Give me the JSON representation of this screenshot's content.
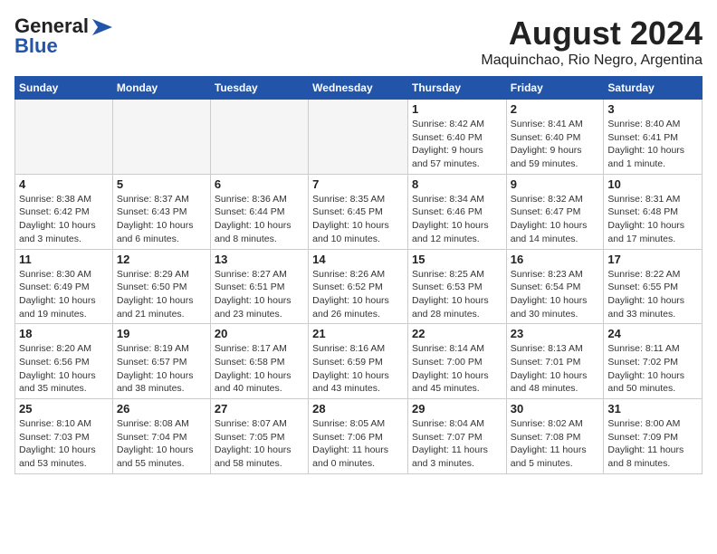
{
  "header": {
    "logo_line1": "General",
    "logo_line2": "Blue",
    "title": "August 2024",
    "subtitle": "Maquinchao, Rio Negro, Argentina"
  },
  "calendar": {
    "days_of_week": [
      "Sunday",
      "Monday",
      "Tuesday",
      "Wednesday",
      "Thursday",
      "Friday",
      "Saturday"
    ],
    "weeks": [
      [
        {
          "day": "",
          "info": ""
        },
        {
          "day": "",
          "info": ""
        },
        {
          "day": "",
          "info": ""
        },
        {
          "day": "",
          "info": ""
        },
        {
          "day": "1",
          "info": "Sunrise: 8:42 AM\nSunset: 6:40 PM\nDaylight: 9 hours\nand 57 minutes."
        },
        {
          "day": "2",
          "info": "Sunrise: 8:41 AM\nSunset: 6:40 PM\nDaylight: 9 hours\nand 59 minutes."
        },
        {
          "day": "3",
          "info": "Sunrise: 8:40 AM\nSunset: 6:41 PM\nDaylight: 10 hours\nand 1 minute."
        }
      ],
      [
        {
          "day": "4",
          "info": "Sunrise: 8:38 AM\nSunset: 6:42 PM\nDaylight: 10 hours\nand 3 minutes."
        },
        {
          "day": "5",
          "info": "Sunrise: 8:37 AM\nSunset: 6:43 PM\nDaylight: 10 hours\nand 6 minutes."
        },
        {
          "day": "6",
          "info": "Sunrise: 8:36 AM\nSunset: 6:44 PM\nDaylight: 10 hours\nand 8 minutes."
        },
        {
          "day": "7",
          "info": "Sunrise: 8:35 AM\nSunset: 6:45 PM\nDaylight: 10 hours\nand 10 minutes."
        },
        {
          "day": "8",
          "info": "Sunrise: 8:34 AM\nSunset: 6:46 PM\nDaylight: 10 hours\nand 12 minutes."
        },
        {
          "day": "9",
          "info": "Sunrise: 8:32 AM\nSunset: 6:47 PM\nDaylight: 10 hours\nand 14 minutes."
        },
        {
          "day": "10",
          "info": "Sunrise: 8:31 AM\nSunset: 6:48 PM\nDaylight: 10 hours\nand 17 minutes."
        }
      ],
      [
        {
          "day": "11",
          "info": "Sunrise: 8:30 AM\nSunset: 6:49 PM\nDaylight: 10 hours\nand 19 minutes."
        },
        {
          "day": "12",
          "info": "Sunrise: 8:29 AM\nSunset: 6:50 PM\nDaylight: 10 hours\nand 21 minutes."
        },
        {
          "day": "13",
          "info": "Sunrise: 8:27 AM\nSunset: 6:51 PM\nDaylight: 10 hours\nand 23 minutes."
        },
        {
          "day": "14",
          "info": "Sunrise: 8:26 AM\nSunset: 6:52 PM\nDaylight: 10 hours\nand 26 minutes."
        },
        {
          "day": "15",
          "info": "Sunrise: 8:25 AM\nSunset: 6:53 PM\nDaylight: 10 hours\nand 28 minutes."
        },
        {
          "day": "16",
          "info": "Sunrise: 8:23 AM\nSunset: 6:54 PM\nDaylight: 10 hours\nand 30 minutes."
        },
        {
          "day": "17",
          "info": "Sunrise: 8:22 AM\nSunset: 6:55 PM\nDaylight: 10 hours\nand 33 minutes."
        }
      ],
      [
        {
          "day": "18",
          "info": "Sunrise: 8:20 AM\nSunset: 6:56 PM\nDaylight: 10 hours\nand 35 minutes."
        },
        {
          "day": "19",
          "info": "Sunrise: 8:19 AM\nSunset: 6:57 PM\nDaylight: 10 hours\nand 38 minutes."
        },
        {
          "day": "20",
          "info": "Sunrise: 8:17 AM\nSunset: 6:58 PM\nDaylight: 10 hours\nand 40 minutes."
        },
        {
          "day": "21",
          "info": "Sunrise: 8:16 AM\nSunset: 6:59 PM\nDaylight: 10 hours\nand 43 minutes."
        },
        {
          "day": "22",
          "info": "Sunrise: 8:14 AM\nSunset: 7:00 PM\nDaylight: 10 hours\nand 45 minutes."
        },
        {
          "day": "23",
          "info": "Sunrise: 8:13 AM\nSunset: 7:01 PM\nDaylight: 10 hours\nand 48 minutes."
        },
        {
          "day": "24",
          "info": "Sunrise: 8:11 AM\nSunset: 7:02 PM\nDaylight: 10 hours\nand 50 minutes."
        }
      ],
      [
        {
          "day": "25",
          "info": "Sunrise: 8:10 AM\nSunset: 7:03 PM\nDaylight: 10 hours\nand 53 minutes."
        },
        {
          "day": "26",
          "info": "Sunrise: 8:08 AM\nSunset: 7:04 PM\nDaylight: 10 hours\nand 55 minutes."
        },
        {
          "day": "27",
          "info": "Sunrise: 8:07 AM\nSunset: 7:05 PM\nDaylight: 10 hours\nand 58 minutes."
        },
        {
          "day": "28",
          "info": "Sunrise: 8:05 AM\nSunset: 7:06 PM\nDaylight: 11 hours\nand 0 minutes."
        },
        {
          "day": "29",
          "info": "Sunrise: 8:04 AM\nSunset: 7:07 PM\nDaylight: 11 hours\nand 3 minutes."
        },
        {
          "day": "30",
          "info": "Sunrise: 8:02 AM\nSunset: 7:08 PM\nDaylight: 11 hours\nand 5 minutes."
        },
        {
          "day": "31",
          "info": "Sunrise: 8:00 AM\nSunset: 7:09 PM\nDaylight: 11 hours\nand 8 minutes."
        }
      ]
    ]
  }
}
